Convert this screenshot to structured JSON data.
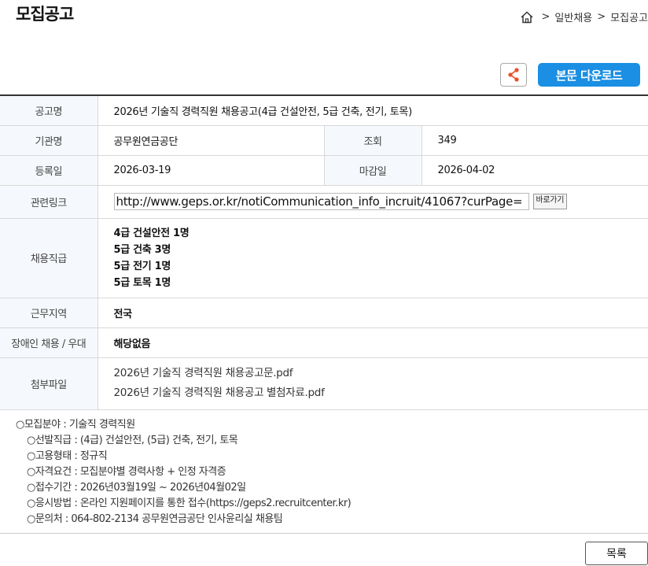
{
  "page": {
    "title": "모집공고"
  },
  "breadcrumb": {
    "items": [
      "일반채용",
      "모집공고"
    ],
    "separator": ">"
  },
  "toolbar": {
    "download_label": "본문 다운로드"
  },
  "table": {
    "rows": {
      "title": {
        "label": "공고명",
        "value": "2026년 기술직 경력직원 채용공고(4급 건설안전, 5급 건축, 전기, 토목)"
      },
      "agency": {
        "label": "기관명",
        "value": "공무원연금공단"
      },
      "views": {
        "label": "조회",
        "value": "349"
      },
      "registered": {
        "label": "등록일",
        "value": "2026-03-19"
      },
      "deadline": {
        "label": "마감일",
        "value": "2026-04-02"
      },
      "link": {
        "label": "관련링크",
        "value": "http://www.geps.or.kr/notiCommunication_info_incruit/41067?curPage=",
        "button": "바로가기"
      },
      "positions": {
        "label": "채용직급",
        "items": [
          "4급 건설안전 1명",
          "5급 건축 3명",
          "5급 전기 1명",
          "5급 토목 1명"
        ]
      },
      "region": {
        "label": "근무지역",
        "value": "전국"
      },
      "disabled": {
        "label": "장애인 채용 / 우대",
        "value": "해당없음"
      },
      "attachments": {
        "label": "첨부파일",
        "files": [
          "2026년 기술직 경력직원 채용공고문.pdf",
          "2026년 기술직 경력직원 채용공고 별첨자료.pdf"
        ]
      }
    }
  },
  "detail": {
    "main": "○모집분야 : 기술직 경력직원",
    "items": [
      "○선발직급 : (4급) 건설안전, (5급) 건축, 전기, 토목",
      "○고용형태 : 정규직",
      "○자격요건 : 모집분야별 경력사항 + 인정 자격증",
      "○접수기간 : 2026년03월19일 ~ 2026년04월02일",
      "○응시방법 : 온라인 지원페이지를 통한 접수(https://geps2.recruitcenter.kr)",
      "○문의처 : 064-802-2134 공무원연금공단 인사윤리실 채용팀"
    ]
  },
  "footer": {
    "list_label": "목록"
  },
  "colors": {
    "accent": "#1a8fe3",
    "header_bg": "#f5f8fc",
    "share_icon": "#e8502a"
  }
}
